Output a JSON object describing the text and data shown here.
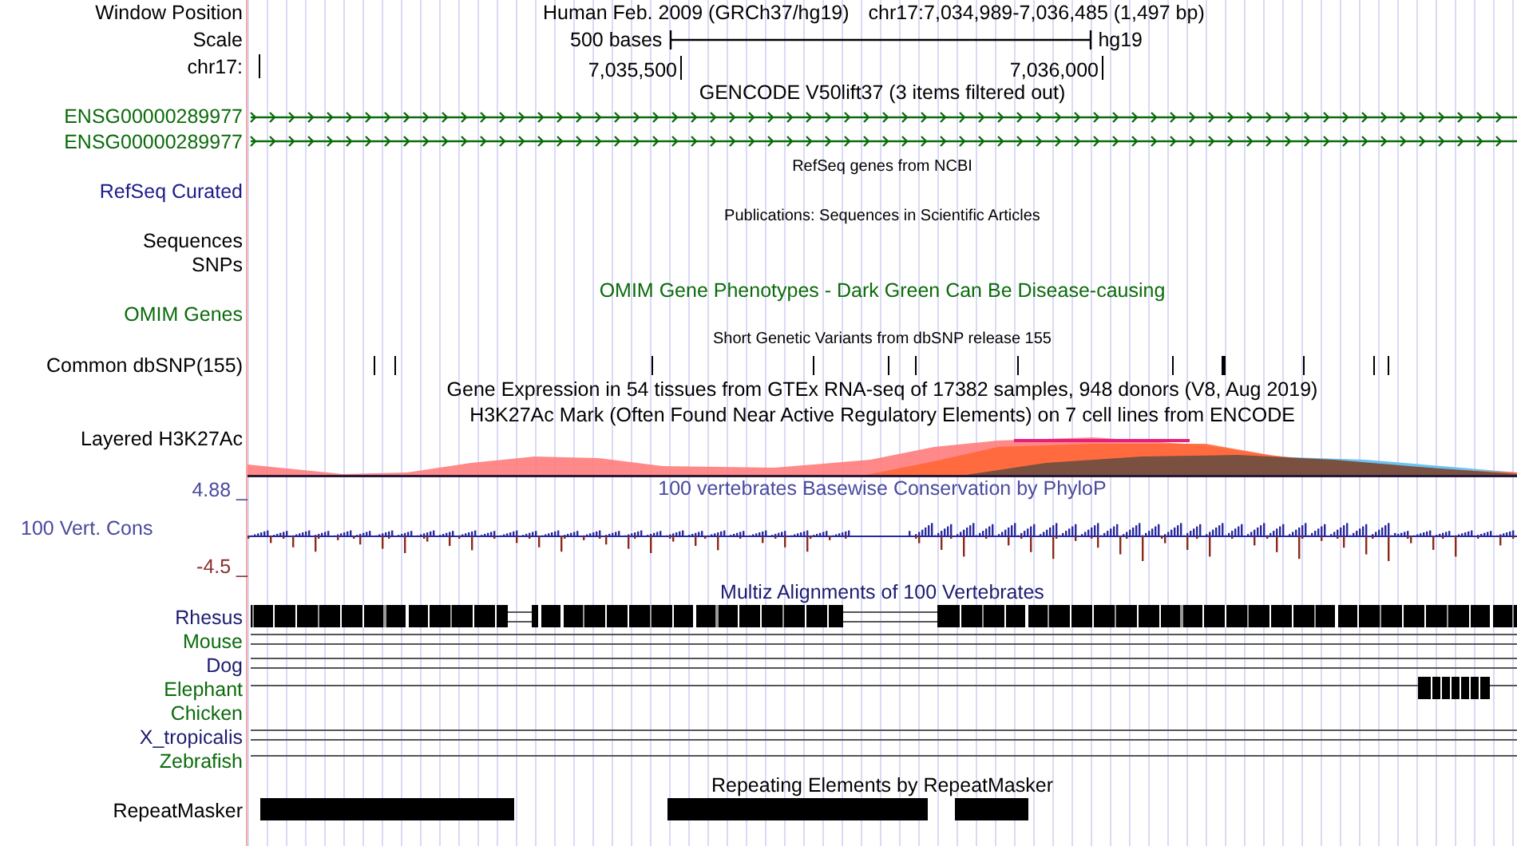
{
  "header": {
    "label": "Window Position",
    "assembly": "Human Feb. 2009 (GRCh37/hg19)",
    "position": "chr17:7,034,989-7,036,485 (1,497 bp)"
  },
  "scale": {
    "label": "Scale",
    "length": "500 bases",
    "assembly": "hg19"
  },
  "ruler": {
    "label": "chr17:",
    "ticks": [
      "7,035,500",
      "7,036,000"
    ]
  },
  "tracks": [
    {
      "kind": "title",
      "text": "GENCODE V50lift37 (3 items filtered out)",
      "color": "#000000"
    },
    {
      "kind": "gene",
      "label": "ENSG00000289977",
      "color": "#0b6b0b"
    },
    {
      "kind": "gene",
      "label": "ENSG00000289977",
      "color": "#0b6b0b"
    },
    {
      "kind": "subtitle",
      "text": "RefSeq genes from NCBI",
      "color": "#000000"
    },
    {
      "kind": "label",
      "label": "RefSeq Curated",
      "color": "#1b1b8a"
    },
    {
      "kind": "subtitle",
      "text": "Publications: Sequences in Scientific Articles",
      "color": "#000000"
    },
    {
      "kind": "label",
      "label": "Sequences",
      "color": "#000000"
    },
    {
      "kind": "label",
      "label": "SNPs",
      "color": "#000000"
    },
    {
      "kind": "title",
      "text": "OMIM Gene Phenotypes - Dark Green Can Be Disease-causing",
      "color": "#0b6b0b"
    },
    {
      "kind": "label",
      "label": "OMIM Genes",
      "color": "#0b6b0b"
    },
    {
      "kind": "subtitle",
      "text": "Short Genetic Variants from dbSNP release 155",
      "color": "#000000"
    },
    {
      "kind": "snp",
      "label": "Common dbSNP(155)",
      "color": "#000000"
    },
    {
      "kind": "title",
      "text": "Gene Expression in 54 tissues from GTEx RNA-seq of 17382 samples, 948 donors (V8, Aug 2019)",
      "color": "#000000"
    },
    {
      "kind": "title",
      "text": "H3K27Ac Mark (Often Found Near Active Regulatory Elements) on 7 cell lines from ENCODE",
      "color": "#000000"
    },
    {
      "kind": "signal",
      "label": "Layered H3K27Ac",
      "color": "#000000"
    },
    {
      "kind": "conservation",
      "text": "100 vertebrates Basewise Conservation by PhyloP",
      "label": "100 Vert. Cons",
      "max": "4.88 _",
      "min": {
        "text": "-4.5 _",
        "color": "#8b2e2e"
      },
      "color": "#4a4a9e"
    },
    {
      "kind": "title",
      "text": "Multiz Alignments of 100 Vertebrates",
      "color": "#1b1b70"
    },
    {
      "kind": "alignment",
      "label": "Rhesus",
      "color": "#1b1b70",
      "alignment": {
        "kind": "blocks"
      }
    },
    {
      "kind": "alignment",
      "label": "Mouse",
      "color": "#0b6b0b",
      "alignment": {
        "kind": "double"
      }
    },
    {
      "kind": "alignment",
      "label": "Dog",
      "color": "#1b1b70",
      "alignment": {
        "kind": "double"
      }
    },
    {
      "kind": "alignment",
      "label": "Elephant",
      "color": "#0b6b0b",
      "alignment": {
        "kind": "line-end-blocks"
      }
    },
    {
      "kind": "alignment",
      "label": "Chicken",
      "color": "#0b6b0b"
    },
    {
      "kind": "alignment",
      "label": "X_tropicalis",
      "color": "#1b1b70",
      "alignment": {
        "kind": "double"
      }
    },
    {
      "kind": "alignment",
      "label": "Zebrafish",
      "color": "#0b6b0b",
      "alignment": {
        "kind": "single"
      }
    },
    {
      "kind": "title",
      "text": "Repeating Elements by RepeatMasker",
      "color": "#000000"
    },
    {
      "kind": "repeat",
      "label": "RepeatMasker",
      "color": "#000000"
    }
  ]
}
